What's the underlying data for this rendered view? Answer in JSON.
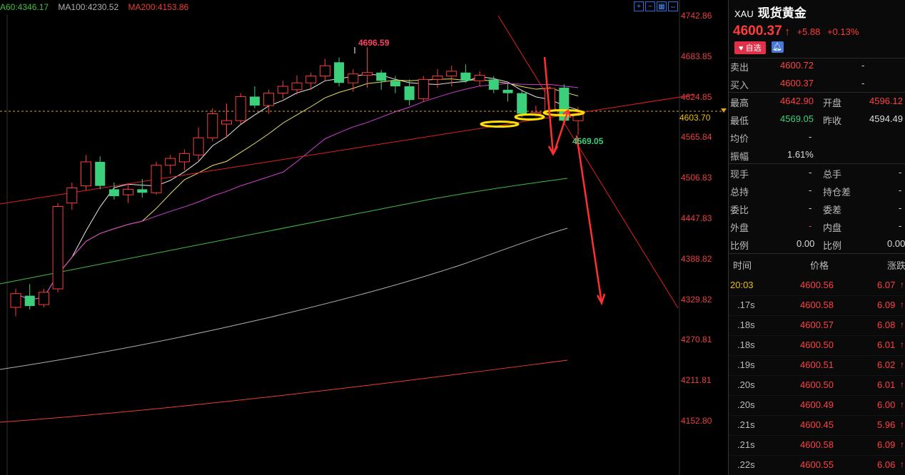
{
  "ma_legend": {
    "ma60": "A60:4346.17",
    "ma100": "MA100:4230.52",
    "ma200": "MA200:4153.86"
  },
  "toolbar_icons": [
    "zoom-in-icon",
    "zoom-out-icon",
    "fit-icon",
    "expand-icon"
  ],
  "price_axis": [
    "4742.86",
    "4683.85",
    "4624.85",
    "4565.84",
    "4506.83",
    "4447.83",
    "4388.82",
    "4329.82",
    "4270.81",
    "4211.81",
    "4152.80"
  ],
  "current_price_tag": "4603.70",
  "annotations": {
    "high": "4696.59",
    "low": "4569.05"
  },
  "colors": {
    "up": "#ff3b3b",
    "down": "#3ccf7c",
    "ma5": "#e8e8e8",
    "ma10": "#e8e060",
    "ma20": "#d040d0",
    "ma60": "#40c040",
    "ma100": "#b0b0b0",
    "ma200": "#e84030"
  },
  "header": {
    "code": "XAU",
    "name": "现货黄金",
    "price": "4600.37",
    "arrow": "↑",
    "change": "+5.88",
    "change_pct": "+0.13%",
    "fav_label": "自选"
  },
  "quotes": {
    "sell_label": "卖出",
    "sell_value": "4600.72",
    "sell_extra": "-",
    "buy_label": "买入",
    "buy_value": "4600.37",
    "buy_extra": "-",
    "high_label": "最高",
    "high_value": "4642.90",
    "open_label": "开盘",
    "open_value": "4596.12",
    "low_label": "最低",
    "low_value": "4569.05",
    "prev_label": "昨收",
    "prev_value": "4594.49",
    "avg_label": "均价",
    "avg_value": "-",
    "amp_label": "振幅",
    "amp_value": "1.61%",
    "cur_vol_label": "现手",
    "cur_vol_value": "-",
    "total_vol_label": "总手",
    "total_vol_value": "-",
    "oi_label": "总持",
    "oi_value": "-",
    "oi_chg_label": "持仓差",
    "oi_chg_value": "-",
    "wb_label": "委比",
    "wb_value": "-",
    "wc_label": "委差",
    "wc_value": "-",
    "outer_label": "外盘",
    "outer_value": "-",
    "inner_label": "内盘",
    "inner_value": "-",
    "ratio1_label": "比例",
    "ratio1_value": "0.00",
    "ratio2_label": "比例",
    "ratio2_value": "0.00"
  },
  "ticks": {
    "headers": {
      "time": "时间",
      "price": "价格",
      "change": "涨跌"
    },
    "rows": [
      {
        "time": "20:03",
        "price": "4600.56",
        "chg": "6.07"
      },
      {
        "time": ".17s",
        "price": "4600.58",
        "chg": "6.09"
      },
      {
        "time": ".18s",
        "price": "4600.57",
        "chg": "6.08"
      },
      {
        "time": ".18s",
        "price": "4600.50",
        "chg": "6.01"
      },
      {
        "time": ".19s",
        "price": "4600.51",
        "chg": "6.02"
      },
      {
        "time": ".20s",
        "price": "4600.50",
        "chg": "6.01"
      },
      {
        "time": ".20s",
        "price": "4600.49",
        "chg": "6.00"
      },
      {
        "time": ".21s",
        "price": "4600.45",
        "chg": "5.96"
      },
      {
        "time": ".21s",
        "price": "4600.58",
        "chg": "6.09"
      },
      {
        "time": ".22s",
        "price": "4600.55",
        "chg": "6.06"
      }
    ]
  },
  "chart_data": {
    "type": "candlestick",
    "ylim": [
      4140,
      4750
    ],
    "candles": [
      {
        "o": 4318,
        "h": 4345,
        "l": 4305,
        "c": 4338
      },
      {
        "o": 4335,
        "h": 4352,
        "l": 4315,
        "c": 4320
      },
      {
        "o": 4322,
        "h": 4345,
        "l": 4318,
        "c": 4340
      },
      {
        "o": 4345,
        "h": 4470,
        "l": 4340,
        "c": 4465
      },
      {
        "o": 4470,
        "h": 4500,
        "l": 4460,
        "c": 4492
      },
      {
        "o": 4495,
        "h": 4540,
        "l": 4488,
        "c": 4530
      },
      {
        "o": 4530,
        "h": 4538,
        "l": 4490,
        "c": 4495
      },
      {
        "o": 4490,
        "h": 4500,
        "l": 4475,
        "c": 4480
      },
      {
        "o": 4482,
        "h": 4498,
        "l": 4470,
        "c": 4490
      },
      {
        "o": 4490,
        "h": 4505,
        "l": 4478,
        "c": 4485
      },
      {
        "o": 4485,
        "h": 4530,
        "l": 4482,
        "c": 4525
      },
      {
        "o": 4525,
        "h": 4540,
        "l": 4512,
        "c": 4535
      },
      {
        "o": 4530,
        "h": 4548,
        "l": 4518,
        "c": 4542
      },
      {
        "o": 4540,
        "h": 4580,
        "l": 4532,
        "c": 4565
      },
      {
        "o": 4565,
        "h": 4608,
        "l": 4560,
        "c": 4600
      },
      {
        "o": 4585,
        "h": 4615,
        "l": 4565,
        "c": 4590
      },
      {
        "o": 4590,
        "h": 4630,
        "l": 4585,
        "c": 4625
      },
      {
        "o": 4625,
        "h": 4640,
        "l": 4608,
        "c": 4612
      },
      {
        "o": 4612,
        "h": 4635,
        "l": 4600,
        "c": 4630
      },
      {
        "o": 4630,
        "h": 4648,
        "l": 4622,
        "c": 4640
      },
      {
        "o": 4635,
        "h": 4656,
        "l": 4628,
        "c": 4645
      },
      {
        "o": 4645,
        "h": 4660,
        "l": 4635,
        "c": 4655
      },
      {
        "o": 4655,
        "h": 4680,
        "l": 4648,
        "c": 4670
      },
      {
        "o": 4675,
        "h": 4682,
        "l": 4640,
        "c": 4645
      },
      {
        "o": 4645,
        "h": 4665,
        "l": 4632,
        "c": 4658
      },
      {
        "o": 4656,
        "h": 4697,
        "l": 4638,
        "c": 4660
      },
      {
        "o": 4660,
        "h": 4664,
        "l": 4635,
        "c": 4648
      },
      {
        "o": 4648,
        "h": 4655,
        "l": 4630,
        "c": 4640
      },
      {
        "o": 4640,
        "h": 4650,
        "l": 4612,
        "c": 4620
      },
      {
        "o": 4622,
        "h": 4655,
        "l": 4618,
        "c": 4650
      },
      {
        "o": 4650,
        "h": 4665,
        "l": 4638,
        "c": 4655
      },
      {
        "o": 4655,
        "h": 4670,
        "l": 4640,
        "c": 4662
      },
      {
        "o": 4660,
        "h": 4672,
        "l": 4645,
        "c": 4648
      },
      {
        "o": 4648,
        "h": 4662,
        "l": 4640,
        "c": 4656
      },
      {
        "o": 4650,
        "h": 4655,
        "l": 4630,
        "c": 4635
      },
      {
        "o": 4635,
        "h": 4645,
        "l": 4618,
        "c": 4630
      },
      {
        "o": 4630,
        "h": 4635,
        "l": 4595,
        "c": 4600
      },
      {
        "o": 4600,
        "h": 4612,
        "l": 4596,
        "c": 4602
      },
      {
        "o": 4604,
        "h": 4640,
        "l": 4600,
        "c": 4637
      },
      {
        "o": 4638,
        "h": 4643,
        "l": 4585,
        "c": 4590
      },
      {
        "o": 4590,
        "h": 4610,
        "l": 4569,
        "c": 4600
      }
    ]
  }
}
